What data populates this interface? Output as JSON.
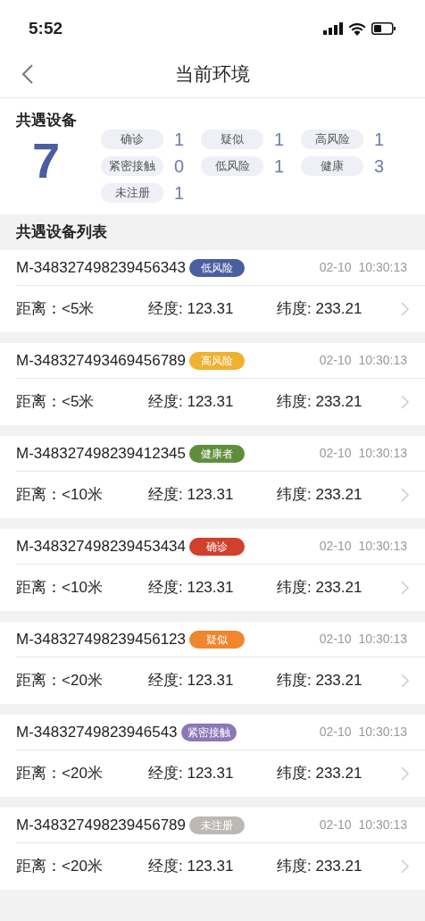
{
  "status_bar": {
    "time": "5:52"
  },
  "nav": {
    "title": "当前环境"
  },
  "summary": {
    "title": "共遇设备",
    "total": "7",
    "stats": [
      {
        "label": "确诊",
        "count": "1"
      },
      {
        "label": "疑似",
        "count": "1"
      },
      {
        "label": "高风险",
        "count": "1"
      },
      {
        "label": "紧密接触",
        "count": "0"
      },
      {
        "label": "低风险",
        "count": "1"
      },
      {
        "label": "健康",
        "count": "3"
      },
      {
        "label": "未注册",
        "count": "1"
      }
    ]
  },
  "list": {
    "title": "共遇设备列表",
    "items": [
      {
        "id": "M-348327498239456343",
        "tag": "低风险",
        "color": "#4a5fa0",
        "date": "02-10",
        "time": "10:30:13",
        "distance": "距离：<5米",
        "longitude": "经度: 123.31",
        "latitude": "纬度: 233.21"
      },
      {
        "id": "M-348327493469456789",
        "tag": "高风险",
        "color": "#f0b030",
        "date": "02-10",
        "time": "10:30:13",
        "distance": "距离：<5米",
        "longitude": "经度: 123.31",
        "latitude": "纬度: 233.21"
      },
      {
        "id": "M-348327498239412345",
        "tag": "健康者",
        "color": "#5e8e3a",
        "date": "02-10",
        "time": "10:30:13",
        "distance": "距离：<10米",
        "longitude": "经度: 123.31",
        "latitude": "纬度: 233.21"
      },
      {
        "id": "M-348327498239453434",
        "tag": "确诊",
        "color": "#d0402a",
        "date": "02-10",
        "time": "10:30:13",
        "distance": "距离：<10米",
        "longitude": "经度: 123.31",
        "latitude": "纬度: 233.21"
      },
      {
        "id": "M-348327498239456123",
        "tag": "疑似",
        "color": "#f0862e",
        "date": "02-10",
        "time": "10:30:13",
        "distance": "距离：<20米",
        "longitude": "经度: 123.31",
        "latitude": "纬度: 233.21"
      },
      {
        "id": "M-34832749823946543",
        "tag": "紧密接触",
        "color": "#8c78b8",
        "date": "02-10",
        "time": "10:30:13",
        "distance": "距离：<20米",
        "longitude": "经度: 123.31",
        "latitude": "纬度: 233.21"
      },
      {
        "id": "M-348327498239456789",
        "tag": "未注册",
        "color": "#bdb8b4",
        "date": "02-10",
        "time": "10:30:13",
        "distance": "距离：<20米",
        "longitude": "经度: 123.31",
        "latitude": "纬度: 233.21"
      }
    ]
  }
}
